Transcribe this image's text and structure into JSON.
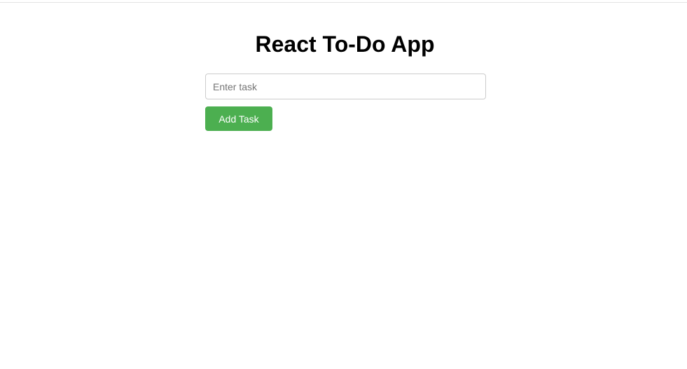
{
  "app": {
    "title": "React To-Do App"
  },
  "task_input": {
    "value": "",
    "placeholder": "Enter task"
  },
  "add_button": {
    "label": "Add Task"
  },
  "colors": {
    "accent": "#4caf50",
    "button_text": "#ffffff",
    "title_text": "#000000",
    "input_border": "#cccccc"
  }
}
